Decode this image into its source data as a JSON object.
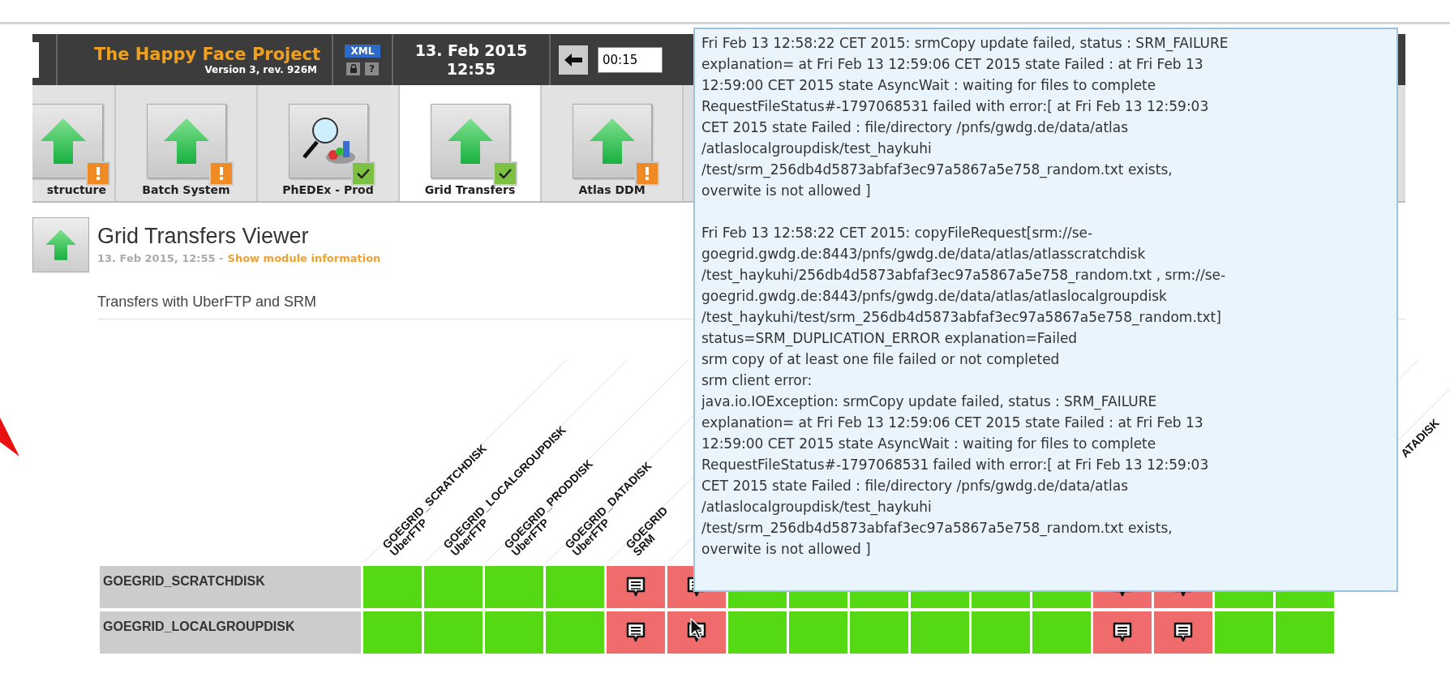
{
  "header": {
    "title": "The Happy Face Project",
    "version": "Version 3, rev. 926M",
    "xml": "XML",
    "help": "?",
    "date": "13. Feb 2015",
    "time": "12:55",
    "interval": "00:15"
  },
  "tabs": [
    {
      "label": "structure",
      "kind": "arrow",
      "badge": {
        "kind": "warning"
      },
      "selected": false
    },
    {
      "label": "Batch System",
      "kind": "arrow",
      "badge": {
        "kind": "warning"
      },
      "selected": false
    },
    {
      "label": "PhEDEx - Prod",
      "kind": "magnifier",
      "badge": {
        "kind": "ok"
      },
      "selected": false
    },
    {
      "label": "Grid Transfers",
      "kind": "arrow",
      "badge": {
        "kind": "ok"
      },
      "selected": true
    },
    {
      "label": "Atlas DDM",
      "kind": "arrow",
      "badge": {
        "kind": "warning"
      },
      "selected": false
    }
  ],
  "module": {
    "title": "Grid Transfers Viewer",
    "timestamp": "13. Feb 2015, 12:55 -",
    "info_link": "Show module information",
    "description": "Transfers with UberFTP and SRM"
  },
  "grid": {
    "columns": [
      {
        "name": "GOEGRID_SCRATCHDISK",
        "sub": "UberFTP"
      },
      {
        "name": "GOEGRID_LOCALGROUPDISK",
        "sub": "UberFTP"
      },
      {
        "name": "GOEGRID_PRODDISK",
        "sub": "UberFTP"
      },
      {
        "name": "GOEGRID_DATADISK",
        "sub": "UberFTP"
      },
      {
        "name": "GOEGRID",
        "sub": "SRM"
      },
      {},
      {},
      {},
      {},
      {},
      {},
      {},
      {},
      {},
      {},
      {
        "name": "ATADISK"
      }
    ],
    "rows": [
      {
        "label": "GOEGRID_SCRATCHDISK",
        "cells": [
          {
            "kind": "ok"
          },
          {
            "kind": "ok"
          },
          {
            "kind": "ok"
          },
          {
            "kind": "ok"
          },
          {
            "kind": "error"
          },
          {
            "kind": "error"
          },
          {
            "kind": "ok"
          },
          {
            "kind": "ok"
          },
          {
            "kind": "ok"
          },
          {
            "kind": "ok"
          },
          {
            "kind": "ok"
          },
          {
            "kind": "ok"
          },
          {
            "kind": "error"
          },
          {
            "kind": "error"
          },
          {
            "kind": "ok"
          },
          {
            "kind": "ok"
          }
        ]
      },
      {
        "label": "GOEGRID_LOCALGROUPDISK",
        "cells": [
          {
            "kind": "ok"
          },
          {
            "kind": "ok"
          },
          {
            "kind": "ok"
          },
          {
            "kind": "ok"
          },
          {
            "kind": "error"
          },
          {
            "kind": "error"
          },
          {
            "kind": "ok"
          },
          {
            "kind": "ok"
          },
          {
            "kind": "ok"
          },
          {
            "kind": "ok"
          },
          {
            "kind": "ok"
          },
          {
            "kind": "ok"
          },
          {
            "kind": "error"
          },
          {
            "kind": "error"
          },
          {
            "kind": "ok"
          },
          {
            "kind": "ok"
          }
        ]
      }
    ]
  },
  "tooltip": {
    "paragraphs": [
      "Fri Feb 13 12:58:22 CET 2015: srmCopy update failed, status : SRM_FAILURE\nexplanation= at Fri Feb 13 12:59:06 CET 2015 state Failed :  at Fri Feb 13\n12:59:00 CET 2015 state AsyncWait : waiting for files to complete\nRequestFileStatus#-1797068531 failed with error:[  at Fri Feb 13 12:59:03\nCET 2015 state Failed : file/directory /pnfs/gwdg.de/data/atlas\n/atlaslocalgroupdisk/test_haykuhi\n/test/srm_256db4d5873abfaf3ec97a5867a5e758_random.txt exists,\noverwite is not allowed ]",
      "Fri Feb 13 12:58:22 CET 2015: copyFileRequest[srm://se-\ngoegrid.gwdg.de:8443/pnfs/gwdg.de/data/atlas/atlasscratchdisk\n/test_haykuhi/256db4d5873abfaf3ec97a5867a5e758_random.txt , srm://se-\ngoegrid.gwdg.de:8443/pnfs/gwdg.de/data/atlas/atlaslocalgroupdisk\n/test_haykuhi/test/srm_256db4d5873abfaf3ec97a5867a5e758_random.txt]\nstatus=SRM_DUPLICATION_ERROR explanation=Failed\nsrm copy of at least one file failed or not completed\nsrm client error:\njava.io.IOException: srmCopy update failed, status : SRM_FAILURE\nexplanation= at Fri Feb 13 12:59:06 CET 2015 state Failed :  at Fri Feb 13\n12:59:00 CET 2015 state AsyncWait : waiting for files to complete\nRequestFileStatus#-1797068531 failed with error:[  at Fri Feb 13 12:59:03\nCET 2015 state Failed : file/directory /pnfs/gwdg.de/data/atlas\n/atlaslocalgroupdisk/test_haykuhi\n/test/srm_256db4d5873abfaf3ec97a5867a5e758_random.txt exists,\noverwite is not allowed ]"
    ]
  }
}
